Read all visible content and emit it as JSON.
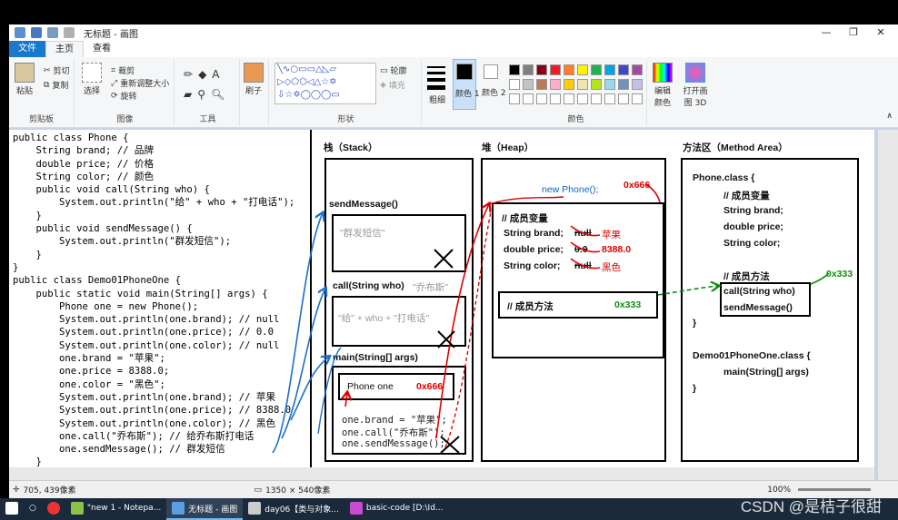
{
  "titlebar": {
    "title": "无标题 - 画图"
  },
  "tabs": {
    "file": "文件",
    "home": "主页",
    "view": "查看"
  },
  "ribbon": {
    "clipboard": {
      "paste": "粘贴",
      "cut": "剪切",
      "copy": "复制",
      "label": "剪贴板"
    },
    "image": {
      "select": "选择",
      "crop": "裁剪",
      "resize": "重新调整大小",
      "rotate": "旋转",
      "label": "图像"
    },
    "tools": {
      "label": "工具"
    },
    "brush": {
      "label": "刷子"
    },
    "shapes": {
      "outline": "轮廓",
      "fill": "填充",
      "label": "形状"
    },
    "size": {
      "label": "粗细"
    },
    "color1": {
      "label": "颜色 1"
    },
    "color2": {
      "label": "颜色 2"
    },
    "colors": {
      "label": "颜色",
      "row1": [
        "#000000",
        "#7f7f7f",
        "#880015",
        "#ed1c24",
        "#ff7f27",
        "#fff200",
        "#22b14c",
        "#00a2e8",
        "#3f48cc",
        "#a349a4"
      ],
      "row2": [
        "#ffffff",
        "#c3c3c3",
        "#b97a57",
        "#ffaec9",
        "#ffc90e",
        "#efe4b0",
        "#b5e61d",
        "#99d9ea",
        "#7092be",
        "#c8bfe7"
      ]
    },
    "edit_colors": "编辑颜色",
    "paint3d": "打开画图 3D"
  },
  "code": {
    "lines": [
      "public class Phone {",
      "    String brand; // 品牌",
      "    double price; // 价格",
      "    String color; // 颜色",
      "    public void call(String who) {",
      "        System.out.println(\"给\" + who + \"打电话\");",
      "    }",
      "    public void sendMessage() {",
      "        System.out.println(\"群发短信\");",
      "    }",
      "}",
      "public class Demo01PhoneOne {",
      "    public static void main(String[] args) {",
      "        Phone one = new Phone();",
      "        System.out.println(one.brand); // null",
      "        System.out.println(one.price); // 0.0",
      "        System.out.println(one.color); // null",
      "        one.brand = \"苹果\";",
      "        one.price = 8388.0;",
      "        one.color = \"黑色\";",
      "        System.out.println(one.brand); // 苹果",
      "        System.out.println(one.price); // 8388.0",
      "        System.out.println(one.color); // 黑色",
      "        one.call(\"乔布斯\"); // 给乔布斯打电话",
      "        one.sendMessage(); // 群发短信",
      "    }"
    ]
  },
  "diagram": {
    "stack": {
      "title": "栈（Stack）",
      "send_message": "sendMessage()",
      "send_message_text": "\"群发短信\"",
      "call": "call(String who)",
      "call_arg": "\"乔布斯\"",
      "call_text": "\"给\" + who + \"打电话\"",
      "main": "main(String[] args)",
      "phone_one": "Phone  one",
      "phone_addr": "0x666",
      "stmt1": "one.brand = \"苹果\";",
      "stmt2": "one.call(\"乔布斯\");",
      "stmt3": "one.sendMessage();"
    },
    "heap": {
      "title": "堆（Heap）",
      "new_phone": "new Phone();",
      "addr": "0x666",
      "members_title": "// 成员变量",
      "brand_label": "String brand;",
      "brand_old": "null",
      "brand_new": "苹果",
      "price_label": "double price;",
      "price_old": "0.0",
      "price_new": "8388.0",
      "color_label": "String color;",
      "color_old": "null",
      "color_new": "黑色",
      "methods": "// 成员方法",
      "methods_addr": "0x333"
    },
    "method_area": {
      "title": "方法区（Method Area）",
      "phone_class": "Phone.class {",
      "members_title": "// 成员变量",
      "brand": "String brand;",
      "price": "double price;",
      "color": "String color;",
      "methods_title": "// 成员方法",
      "methods_addr": "0x333",
      "call": "call(String who)",
      "send": "sendMessage()",
      "close1": "}",
      "demo_class": "Demo01PhoneOne.class {",
      "main": "main(String[] args)",
      "close2": "}"
    }
  },
  "status": {
    "cursor": "705, 439像素",
    "size": "1350 × 540像素",
    "zoom": "100%"
  },
  "taskbar": {
    "items": [
      "\"new 1 - Notepa...",
      "无标题 - 画图",
      "day06【类与对象...",
      "basic-code [D:\\Id..."
    ]
  },
  "watermark": "CSDN @是桔子很甜"
}
